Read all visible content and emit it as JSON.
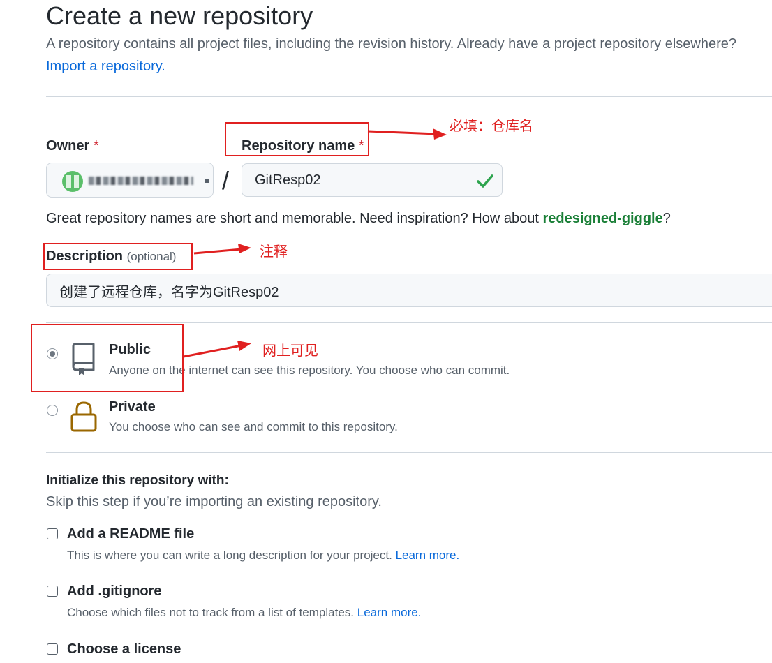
{
  "header": {
    "title": "Create a new repository",
    "subtitle": "A repository contains all project files, including the revision history. Already have a project repository elsewhere?",
    "import_link": "Import a repository."
  },
  "owner": {
    "label": "Owner",
    "required_mark": "*",
    "separator": "/"
  },
  "repo_name": {
    "label": "Repository name",
    "required_mark": "*",
    "value": "GitResp02",
    "hint_prefix": "Great repository names are short and memorable. Need inspiration? How about ",
    "suggestion": "redesigned-giggle",
    "hint_suffix": "?"
  },
  "description": {
    "label": "Description",
    "optional": "(optional)",
    "value": "创建了远程仓库，名字为GitResp02"
  },
  "visibility": {
    "public": {
      "title": "Public",
      "desc": "Anyone on the internet can see this repository. You choose who can commit.",
      "selected": true
    },
    "private": {
      "title": "Private",
      "desc": "You choose who can see and commit to this repository.",
      "selected": false
    }
  },
  "initialize": {
    "title": "Initialize this repository with:",
    "subtitle": "Skip this step if you’re importing an existing repository.",
    "readme": {
      "title": "Add a README file",
      "desc": "This is where you can write a long description for your project.",
      "link": "Learn more."
    },
    "gitignore": {
      "title": "Add .gitignore",
      "desc": "Choose which files not to track from a list of templates.",
      "link": "Learn more."
    },
    "license": {
      "title": "Choose a license"
    }
  },
  "annotations": {
    "repo_name_note": "必填：仓库名",
    "description_note": "注释",
    "public_note": "网上可见",
    "color": "#e02020"
  },
  "colors": {
    "link": "#0969da",
    "suggestion": "#1a7f37",
    "required": "#cf222e",
    "valid_check": "#2da44e",
    "lock": "#9a6700"
  }
}
